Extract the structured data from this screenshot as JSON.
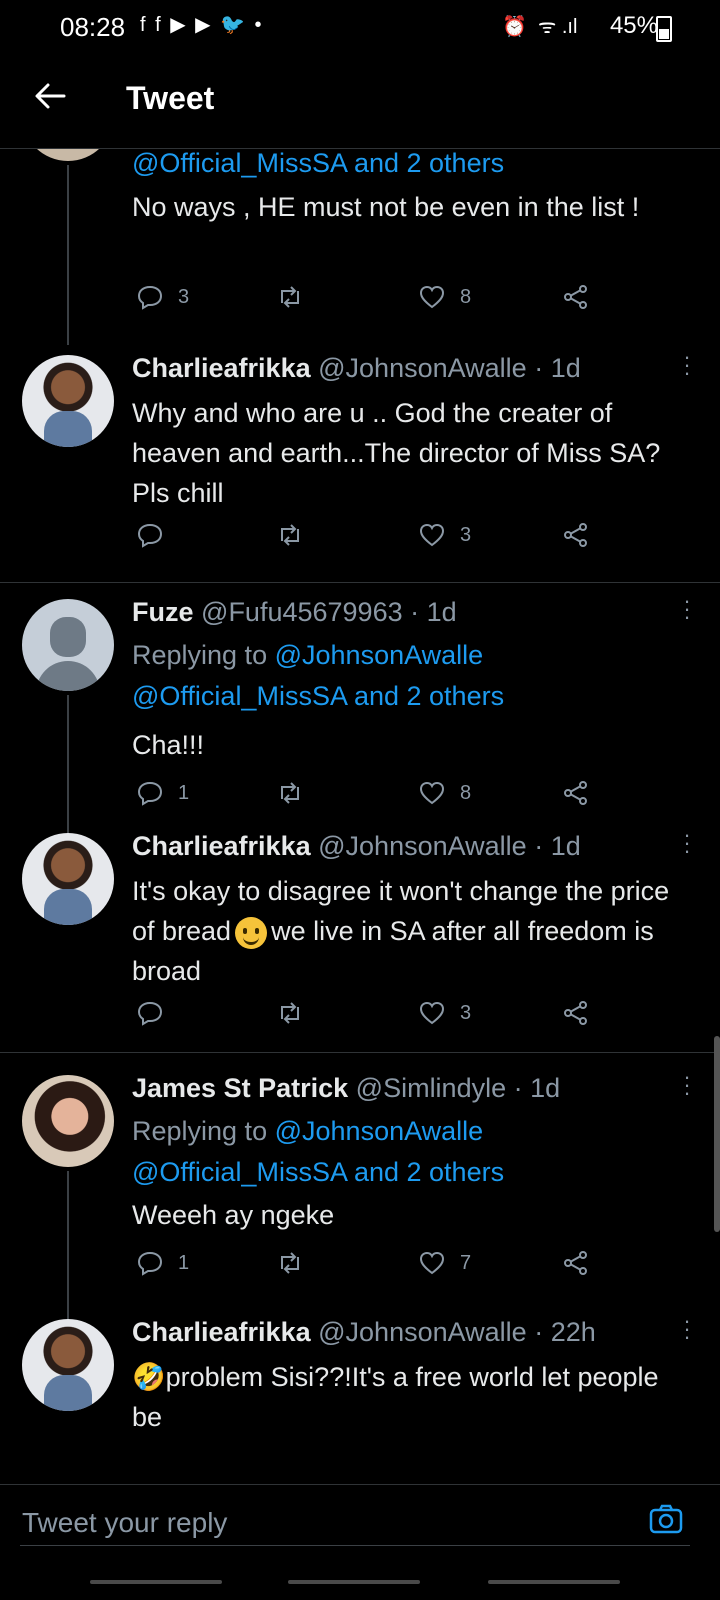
{
  "status_bar": {
    "time": "08:28",
    "battery": "45%",
    "app_icons": "f f ▶ ▶ 🐦 •",
    "right_icons": "⏰ ︎ ᯤ .ıl"
  },
  "header": {
    "title": "Tweet"
  },
  "tweets": [
    {
      "reply_link": "@Official_MissSA and 2 others",
      "text": "No ways , HE must not be even in the list !",
      "replies": "3",
      "likes": "8"
    },
    {
      "name": "Charlieafrikka",
      "handle": "@JohnsonAwalle",
      "dot": "·",
      "time": "1d",
      "text": "Why and who are u .. God the creater of heaven and earth...The director of Miss SA? Pls chill",
      "replies": "",
      "likes": "3"
    },
    {
      "name": "Fuze",
      "handle": "@Fufu45679963",
      "dot": "·",
      "time": "1d",
      "replying_prefix": "Replying to",
      "replying_to": "@JohnsonAwalle",
      "reply_link": "@Official_MissSA and 2 others",
      "text": "Cha!!!",
      "replies": "1",
      "likes": "8"
    },
    {
      "name": "Charlieafrikka",
      "handle": "@JohnsonAwalle",
      "dot": "·",
      "time": "1d",
      "text_a": "It's okay to disagree it won't change the price of bread",
      "text_b": "we live in SA after all freedom is broad",
      "replies": "",
      "likes": "3"
    },
    {
      "name": "James St Patrick",
      "handle": "@Simlindyle",
      "dot": "·",
      "time": "1d",
      "replying_prefix": "Replying to",
      "replying_to": "@JohnsonAwalle",
      "reply_link": "@Official_MissSA and 2 others",
      "text": "Weeeh ay ngeke",
      "replies": "1",
      "likes": "7"
    },
    {
      "name": "Charlieafrikka",
      "handle": "@JohnsonAwalle",
      "dot": "·",
      "time": "22h",
      "emoji": "🤣",
      "text": "problem Sisi??!It's a free world let people be"
    }
  ],
  "composer": {
    "placeholder": "Tweet your reply"
  }
}
